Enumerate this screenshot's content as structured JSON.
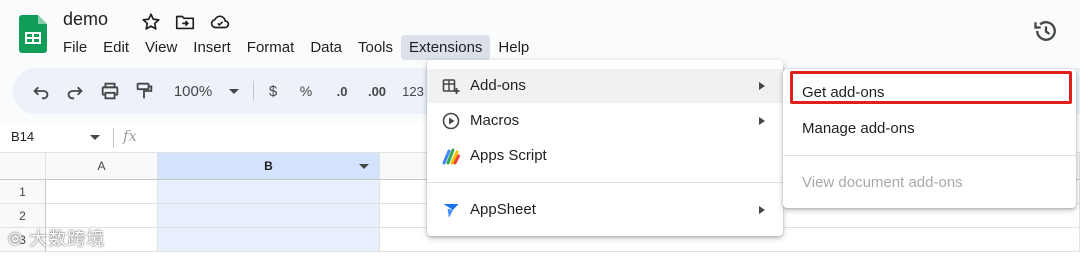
{
  "app": {
    "doc_title": "demo",
    "menubar": [
      "File",
      "Edit",
      "View",
      "Insert",
      "Format",
      "Data",
      "Tools",
      "Extensions",
      "Help"
    ],
    "active_menu": "Extensions"
  },
  "toolbar": {
    "zoom": "100%",
    "currency": "$",
    "percent": "%",
    "decrease_decimal": ".0",
    "increase_decimal": ".00",
    "more_formats": "123"
  },
  "formula_bar": {
    "name_box": "B14",
    "fx": "fx"
  },
  "grid": {
    "columns": [
      "A",
      "B"
    ],
    "selected_column": "B",
    "rows": [
      "1",
      "2",
      "3"
    ]
  },
  "extensions_menu": {
    "items": [
      {
        "label": "Add-ons",
        "icon": "add-ons-icon",
        "submenu": true
      },
      {
        "label": "Macros",
        "icon": "macros-icon",
        "submenu": true
      },
      {
        "label": "Apps Script",
        "icon": "apps-script-icon",
        "submenu": false
      },
      {
        "label": "AppSheet",
        "icon": "appsheet-icon",
        "submenu": true
      }
    ]
  },
  "addons_submenu": {
    "items": [
      {
        "label": "Get add-ons",
        "disabled": false,
        "highlighted": true
      },
      {
        "label": "Manage add-ons",
        "disabled": false
      },
      {
        "label": "View document add-ons",
        "disabled": true
      }
    ]
  },
  "watermark": "大数跨境",
  "colors": {
    "sheets_green": "#0f9d58",
    "highlight_red": "#e0201c",
    "selected_column": "#d3e3fd",
    "toolbar_bg": "#edf2fa"
  }
}
